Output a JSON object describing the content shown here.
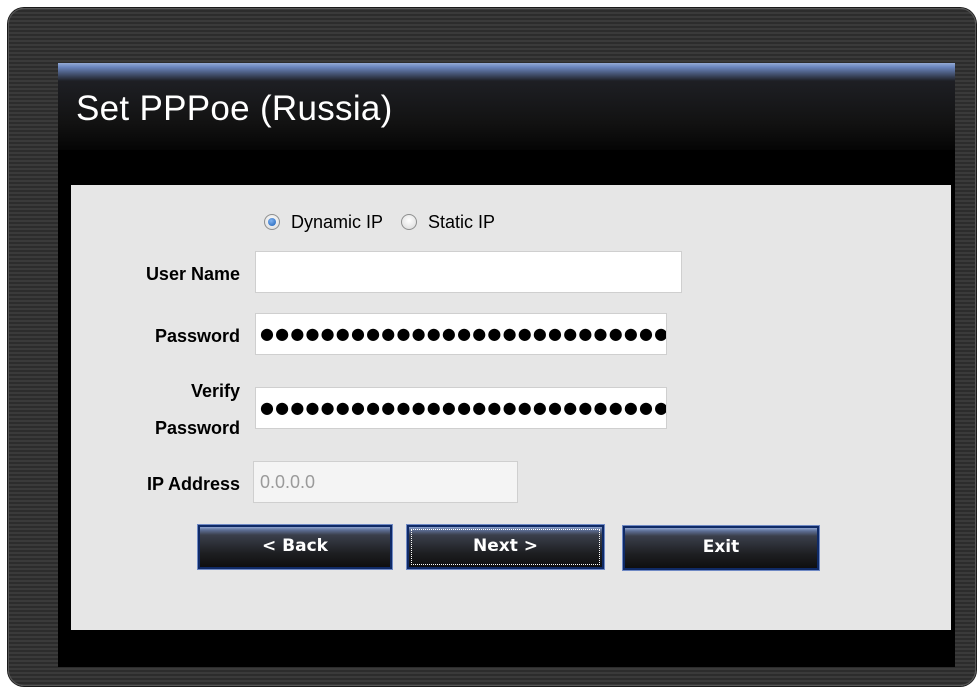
{
  "title": "Set PPPoe (Russia)",
  "ip_mode": {
    "options": [
      {
        "label": "Dynamic IP",
        "checked": true
      },
      {
        "label": "Static IP",
        "checked": false
      }
    ]
  },
  "fields": {
    "user_name": {
      "label": "User Name",
      "value": ""
    },
    "password": {
      "label": "Password",
      "value": "●●●●●●●●●●●●●●●●●●●●●●●●●●●●"
    },
    "verify_password": {
      "label_line1": "Verify",
      "label_line2": "Password",
      "value": "●●●●●●●●●●●●●●●●●●●●●●●●●●●●"
    },
    "ip_address": {
      "label": "IP Address",
      "value": "0.0.0.0"
    }
  },
  "buttons": {
    "back": "< Back",
    "next": "Next >",
    "exit": "Exit"
  },
  "colors": {
    "accent": "#1b5fb5",
    "button_border": "#0f2a66"
  }
}
